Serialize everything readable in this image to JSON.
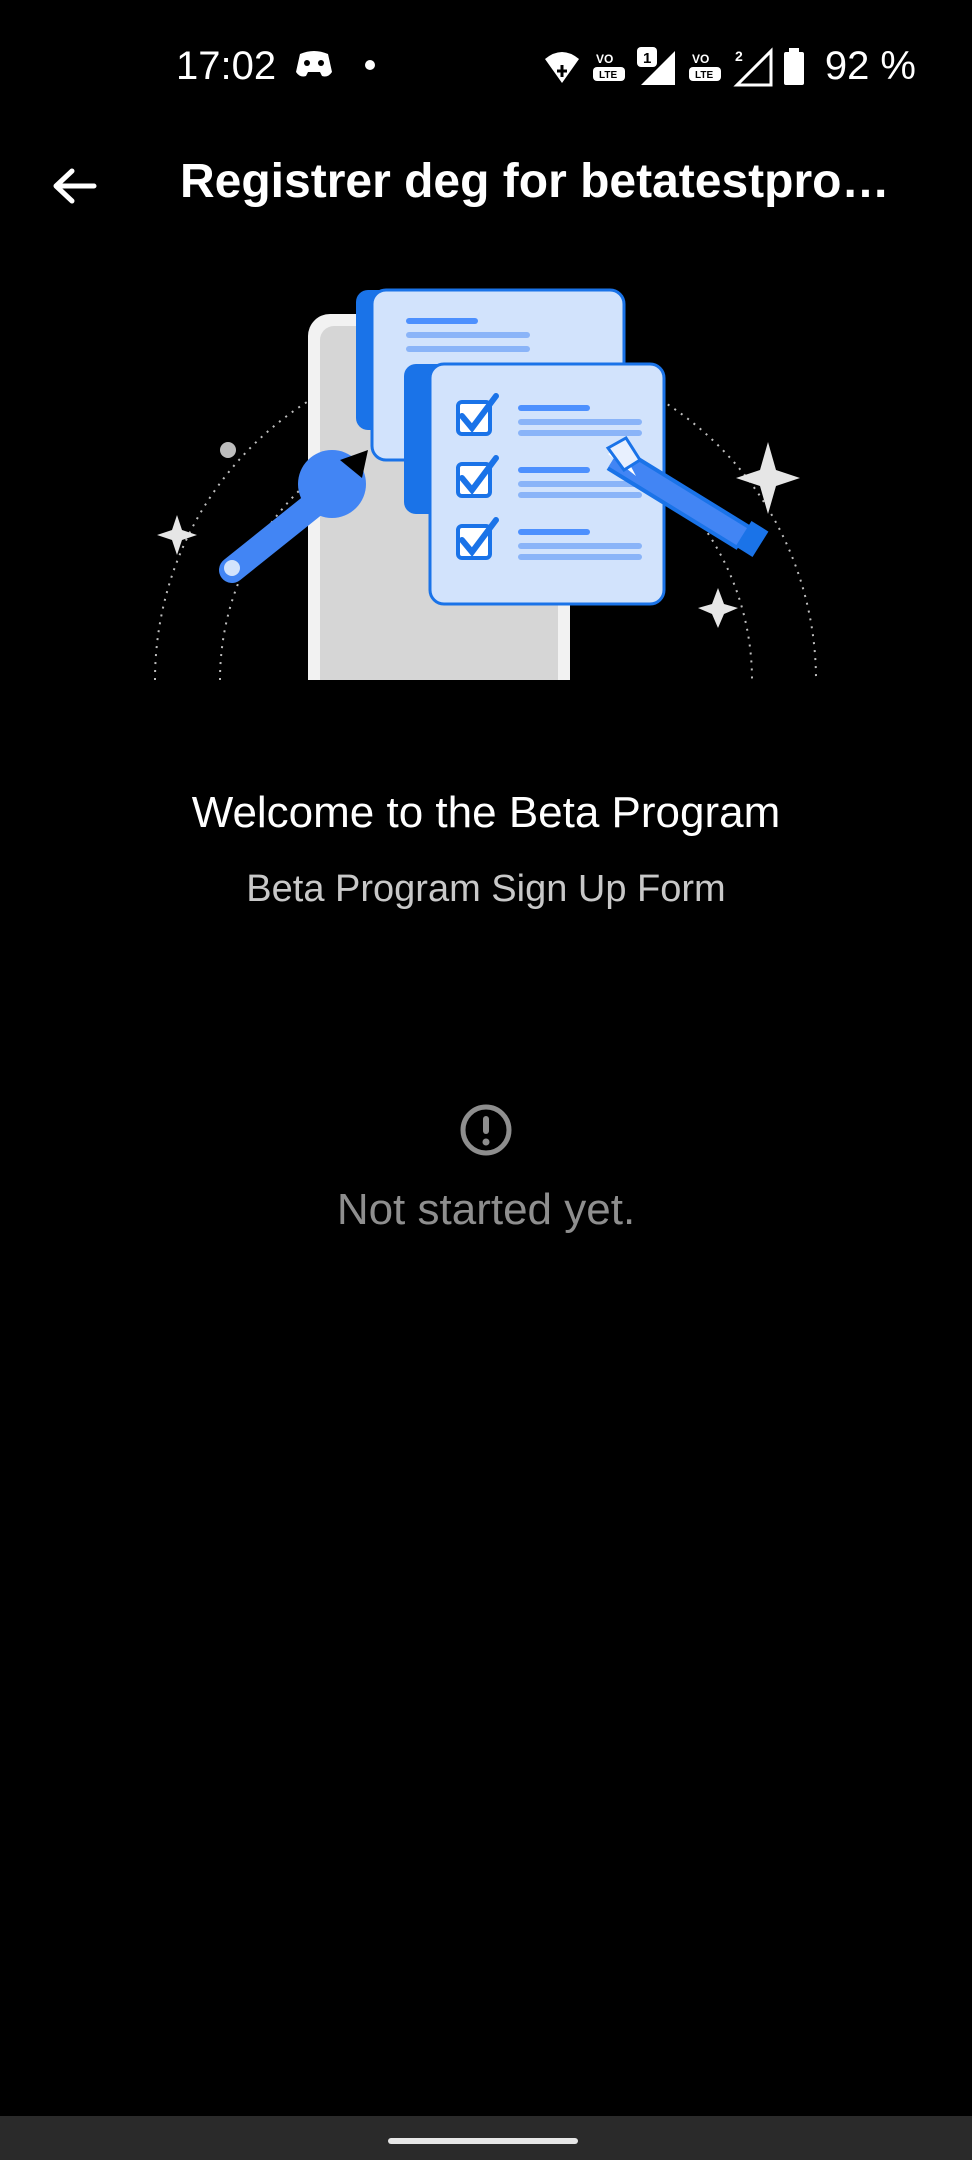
{
  "status_bar": {
    "time": "17:02",
    "battery": "92 %",
    "sim1": "1",
    "sim2": "2"
  },
  "app_bar": {
    "title": "Registrer deg for betatestpro…"
  },
  "content": {
    "welcome_title": "Welcome to the Beta Program",
    "welcome_subtitle": "Beta Program Sign Up Form",
    "status_message": "Not started yet."
  },
  "colors": {
    "background": "#000000",
    "accent_blue": "#1a73e8",
    "paper_light": "#d2e3fc",
    "muted_text": "#8e8e8e",
    "nav_bar": "#2a2a2a"
  },
  "icons": {
    "back": "arrow-back-icon",
    "status": "exclamation-circle-icon",
    "wifi": "wifi-icon",
    "signal": "signal-icon",
    "battery": "battery-icon"
  }
}
